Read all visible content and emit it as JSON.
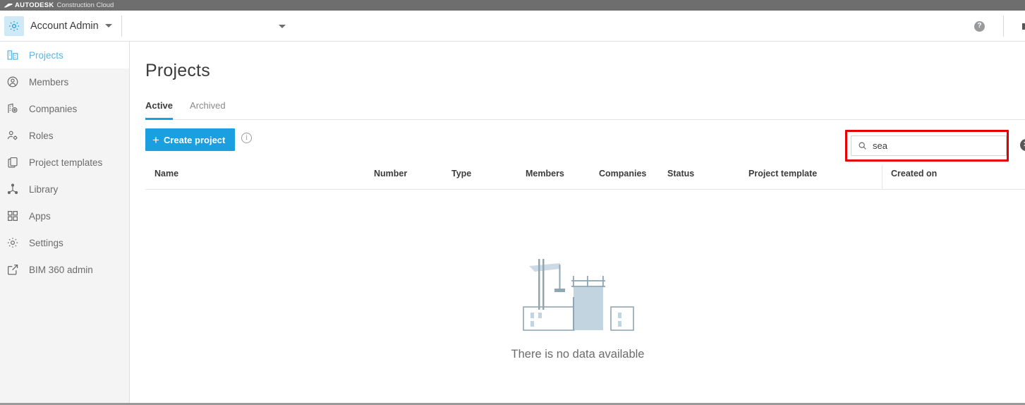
{
  "brand": {
    "logo_icon": "autodesk-logo-icon",
    "company": "AUTODESK",
    "product": "Construction Cloud"
  },
  "topnav": {
    "gear_icon": "gear-icon",
    "account_label": "Account Admin",
    "account_caret_icon": "chevron-down-icon",
    "project_selector_value": "",
    "project_selector_caret_icon": "chevron-down-icon",
    "help_icon": "help-icon",
    "help_glyph": "?"
  },
  "sidebar": {
    "items": [
      {
        "label": "Projects",
        "icon": "building-icon",
        "active": true
      },
      {
        "label": "Members",
        "icon": "person-circle-icon",
        "active": false
      },
      {
        "label": "Companies",
        "icon": "company-icon",
        "active": false
      },
      {
        "label": "Roles",
        "icon": "person-gear-icon",
        "active": false
      },
      {
        "label": "Project templates",
        "icon": "copy-icon",
        "active": false
      },
      {
        "label": "Library",
        "icon": "library-node-icon",
        "active": false
      },
      {
        "label": "Apps",
        "icon": "grid-apps-icon",
        "active": false
      },
      {
        "label": "Settings",
        "icon": "gear-icon",
        "active": false
      },
      {
        "label": "BIM 360 admin",
        "icon": "external-link-icon",
        "active": false
      }
    ]
  },
  "main": {
    "page_title": "Projects",
    "tabs": [
      {
        "label": "Active",
        "selected": true
      },
      {
        "label": "Archived",
        "selected": false
      }
    ],
    "create_button": {
      "label": "Create project",
      "icon": "plus-icon"
    },
    "info_icon": "info-icon",
    "info_glyph": "i",
    "search": {
      "icon": "search-icon",
      "value": "sea",
      "placeholder": "",
      "clear_icon": "close-circle-icon",
      "clear_glyph": "✕"
    },
    "table": {
      "columns": [
        "Name",
        "Number",
        "Type",
        "Members",
        "Companies",
        "Status",
        "Project template",
        "Created on"
      ]
    },
    "empty_state": {
      "illustration": "construction-site-illustration",
      "message": "There is no data available"
    }
  },
  "colors": {
    "accent": "#1a9fe0",
    "accent_light": "#5ab6e4",
    "brandbar": "#6e6e6e",
    "sidebar_bg": "#f4f4f4",
    "highlight_red": "#e60000",
    "illustration_fill": "#c2d4e0"
  }
}
